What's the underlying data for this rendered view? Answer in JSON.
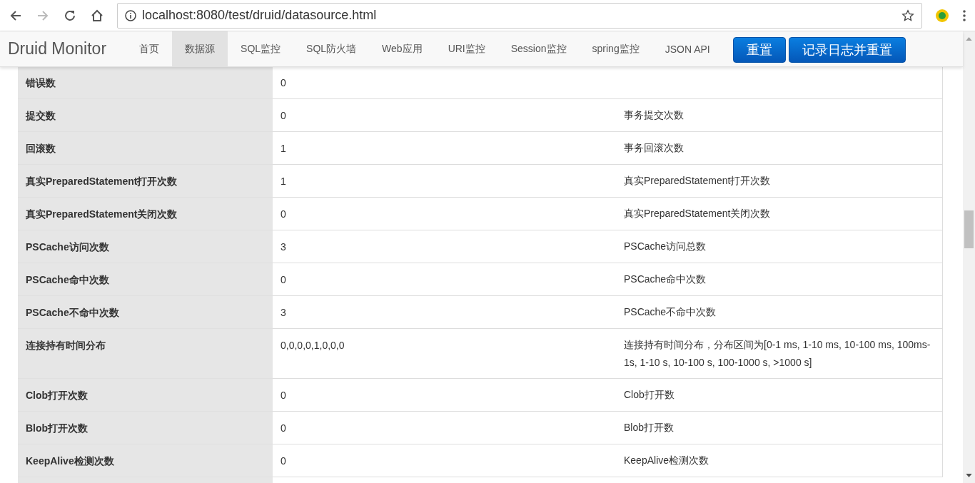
{
  "browser": {
    "url": "localhost:8080/test/druid/datasource.html"
  },
  "navbar": {
    "brand": "Druid Monitor",
    "tabs": [
      {
        "label": "首页",
        "selected": false
      },
      {
        "label": "数据源",
        "selected": true
      },
      {
        "label": "SQL监控",
        "selected": false
      },
      {
        "label": "SQL防火墙",
        "selected": false
      },
      {
        "label": "Web应用",
        "selected": false
      },
      {
        "label": "URI监控",
        "selected": false
      },
      {
        "label": "Session监控",
        "selected": false
      },
      {
        "label": "spring监控",
        "selected": false
      },
      {
        "label": "JSON API",
        "selected": false
      }
    ],
    "buttons": [
      "重置",
      "记录日志并重置"
    ]
  },
  "table": {
    "rows": [
      {
        "name": "错误数",
        "value": "0"
      },
      {
        "name": "提交数",
        "value": "0",
        "description": "事务提交次数"
      },
      {
        "name": "回滚数",
        "value": "1",
        "description": "事务回滚次数"
      },
      {
        "name": "真实PreparedStatement打开次数",
        "value": "1",
        "description": "真实PreparedStatement打开次数"
      },
      {
        "name": "真实PreparedStatement关闭次数",
        "value": "0",
        "description": "真实PreparedStatement关闭次数"
      },
      {
        "name": "PSCache访问次数",
        "value": "3",
        "description": "PSCache访问总数"
      },
      {
        "name": "PSCache命中次数",
        "value": "0",
        "description": "PSCache命中次数"
      },
      {
        "name": "PSCache不命中次数",
        "value": "3",
        "description": "PSCache不命中次数"
      },
      {
        "name": "连接持有时间分布",
        "value": "0,0,0,0,1,0,0,0",
        "description": "连接持有时间分布，分布区间为[0-1 ms, 1-10 ms, 10-100 ms, 100ms-1s, 1-10 s, 10-100 s, 100-1000 s, >1000 s]"
      },
      {
        "name": "Clob打开次数",
        "value": "0",
        "description": "Clob打开数"
      },
      {
        "name": "Blob打开次数",
        "value": "0",
        "description": "Blob打开数"
      },
      {
        "name": "KeepAlive检测次数",
        "value": "0",
        "description": "KeepAlive检测次数"
      }
    ]
  }
}
